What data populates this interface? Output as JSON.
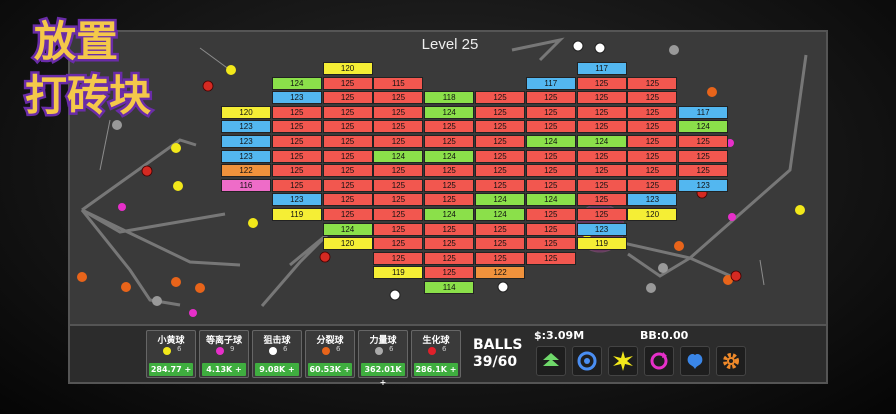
{
  "logo": {
    "line1": "放置",
    "line2": "打砖块"
  },
  "level": "Level 25",
  "hud": {
    "balls_label": "BALLS",
    "balls_count": "39/60",
    "money": "$:3.09M",
    "bb": "BB:0.00"
  },
  "ball_types": [
    {
      "name": "小黄球",
      "count": "6",
      "price": "284.77",
      "color": "#f2e81a"
    },
    {
      "name": "等离子球",
      "count": "9",
      "price": "4.13K",
      "color": "#e62fc9"
    },
    {
      "name": "狙击球",
      "count": "6",
      "price": "9.08K",
      "color": "#ffffff"
    },
    {
      "name": "分裂球",
      "count": "6",
      "price": "60.53K",
      "color": "#e8641a"
    },
    {
      "name": "力量球",
      "count": "6",
      "price": "362.01K",
      "color": "#aaaaaa"
    },
    {
      "name": "生化球",
      "count": "6",
      "price": "286.1K",
      "color": "#e0202a"
    }
  ],
  "tools": [
    "upgrade-arrows-icon",
    "vortex-icon",
    "burst-icon",
    "refresh-icon",
    "brain-icon",
    "gear-icon"
  ],
  "colors": {
    "red": "#f2574f",
    "green": "#8be04a",
    "blue": "#53b7f0",
    "yellow": "#f5ee35",
    "pink": "#ee6cc8",
    "orange": "#f0923c"
  },
  "bricks": [
    {
      "c": 2,
      "r": 0,
      "v": "120",
      "k": "yellow"
    },
    {
      "c": 7,
      "r": 0,
      "v": "117",
      "k": "blue"
    },
    {
      "c": 1,
      "r": 1,
      "v": "124",
      "k": "green"
    },
    {
      "c": 2,
      "r": 1,
      "v": "125",
      "k": "red"
    },
    {
      "c": 3,
      "r": 1,
      "v": "115",
      "k": "red"
    },
    {
      "c": 6,
      "r": 1,
      "v": "117",
      "k": "blue"
    },
    {
      "c": 7,
      "r": 1,
      "v": "125",
      "k": "red"
    },
    {
      "c": 8,
      "r": 1,
      "v": "125",
      "k": "red"
    },
    {
      "c": 1,
      "r": 2,
      "v": "123",
      "k": "blue"
    },
    {
      "c": 2,
      "r": 2,
      "v": "125",
      "k": "red"
    },
    {
      "c": 3,
      "r": 2,
      "v": "125",
      "k": "red"
    },
    {
      "c": 4,
      "r": 2,
      "v": "118",
      "k": "green"
    },
    {
      "c": 5,
      "r": 2,
      "v": "125",
      "k": "red"
    },
    {
      "c": 6,
      "r": 2,
      "v": "125",
      "k": "red"
    },
    {
      "c": 7,
      "r": 2,
      "v": "125",
      "k": "red"
    },
    {
      "c": 8,
      "r": 2,
      "v": "125",
      "k": "red"
    },
    {
      "c": 0,
      "r": 3,
      "v": "120",
      "k": "yellow"
    },
    {
      "c": 1,
      "r": 3,
      "v": "125",
      "k": "red"
    },
    {
      "c": 2,
      "r": 3,
      "v": "125",
      "k": "red"
    },
    {
      "c": 3,
      "r": 3,
      "v": "125",
      "k": "red"
    },
    {
      "c": 4,
      "r": 3,
      "v": "124",
      "k": "green"
    },
    {
      "c": 5,
      "r": 3,
      "v": "125",
      "k": "red"
    },
    {
      "c": 6,
      "r": 3,
      "v": "125",
      "k": "red"
    },
    {
      "c": 7,
      "r": 3,
      "v": "125",
      "k": "red"
    },
    {
      "c": 8,
      "r": 3,
      "v": "125",
      "k": "red"
    },
    {
      "c": 9,
      "r": 3,
      "v": "117",
      "k": "blue"
    },
    {
      "c": 0,
      "r": 4,
      "v": "123",
      "k": "blue"
    },
    {
      "c": 1,
      "r": 4,
      "v": "125",
      "k": "red"
    },
    {
      "c": 2,
      "r": 4,
      "v": "125",
      "k": "red"
    },
    {
      "c": 3,
      "r": 4,
      "v": "125",
      "k": "red"
    },
    {
      "c": 4,
      "r": 4,
      "v": "125",
      "k": "red"
    },
    {
      "c": 5,
      "r": 4,
      "v": "125",
      "k": "red"
    },
    {
      "c": 6,
      "r": 4,
      "v": "125",
      "k": "red"
    },
    {
      "c": 7,
      "r": 4,
      "v": "125",
      "k": "red"
    },
    {
      "c": 8,
      "r": 4,
      "v": "125",
      "k": "red"
    },
    {
      "c": 9,
      "r": 4,
      "v": "124",
      "k": "green"
    },
    {
      "c": 0,
      "r": 5,
      "v": "123",
      "k": "blue"
    },
    {
      "c": 1,
      "r": 5,
      "v": "125",
      "k": "red"
    },
    {
      "c": 2,
      "r": 5,
      "v": "125",
      "k": "red"
    },
    {
      "c": 3,
      "r": 5,
      "v": "125",
      "k": "red"
    },
    {
      "c": 4,
      "r": 5,
      "v": "125",
      "k": "red"
    },
    {
      "c": 5,
      "r": 5,
      "v": "125",
      "k": "red"
    },
    {
      "c": 6,
      "r": 5,
      "v": "124",
      "k": "green"
    },
    {
      "c": 7,
      "r": 5,
      "v": "124",
      "k": "green"
    },
    {
      "c": 8,
      "r": 5,
      "v": "125",
      "k": "red"
    },
    {
      "c": 9,
      "r": 5,
      "v": "125",
      "k": "red"
    },
    {
      "c": 0,
      "r": 6,
      "v": "123",
      "k": "blue"
    },
    {
      "c": 1,
      "r": 6,
      "v": "125",
      "k": "red"
    },
    {
      "c": 2,
      "r": 6,
      "v": "125",
      "k": "red"
    },
    {
      "c": 3,
      "r": 6,
      "v": "124",
      "k": "green"
    },
    {
      "c": 4,
      "r": 6,
      "v": "124",
      "k": "green"
    },
    {
      "c": 5,
      "r": 6,
      "v": "125",
      "k": "red"
    },
    {
      "c": 6,
      "r": 6,
      "v": "125",
      "k": "red"
    },
    {
      "c": 7,
      "r": 6,
      "v": "125",
      "k": "red"
    },
    {
      "c": 8,
      "r": 6,
      "v": "125",
      "k": "red"
    },
    {
      "c": 9,
      "r": 6,
      "v": "125",
      "k": "red"
    },
    {
      "c": 0,
      "r": 7,
      "v": "122",
      "k": "orange"
    },
    {
      "c": 1,
      "r": 7,
      "v": "125",
      "k": "red"
    },
    {
      "c": 2,
      "r": 7,
      "v": "125",
      "k": "red"
    },
    {
      "c": 3,
      "r": 7,
      "v": "125",
      "k": "red"
    },
    {
      "c": 4,
      "r": 7,
      "v": "125",
      "k": "red"
    },
    {
      "c": 5,
      "r": 7,
      "v": "125",
      "k": "red"
    },
    {
      "c": 6,
      "r": 7,
      "v": "125",
      "k": "red"
    },
    {
      "c": 7,
      "r": 7,
      "v": "125",
      "k": "red"
    },
    {
      "c": 8,
      "r": 7,
      "v": "125",
      "k": "red"
    },
    {
      "c": 9,
      "r": 7,
      "v": "125",
      "k": "red"
    },
    {
      "c": 0,
      "r": 8,
      "v": "116",
      "k": "pink"
    },
    {
      "c": 1,
      "r": 8,
      "v": "125",
      "k": "red"
    },
    {
      "c": 2,
      "r": 8,
      "v": "125",
      "k": "red"
    },
    {
      "c": 3,
      "r": 8,
      "v": "125",
      "k": "red"
    },
    {
      "c": 4,
      "r": 8,
      "v": "125",
      "k": "red"
    },
    {
      "c": 5,
      "r": 8,
      "v": "125",
      "k": "red"
    },
    {
      "c": 6,
      "r": 8,
      "v": "125",
      "k": "red"
    },
    {
      "c": 7,
      "r": 8,
      "v": "125",
      "k": "red"
    },
    {
      "c": 8,
      "r": 8,
      "v": "125",
      "k": "red"
    },
    {
      "c": 9,
      "r": 8,
      "v": "123",
      "k": "blue"
    },
    {
      "c": 1,
      "r": 9,
      "v": "123",
      "k": "blue"
    },
    {
      "c": 2,
      "r": 9,
      "v": "125",
      "k": "red"
    },
    {
      "c": 3,
      "r": 9,
      "v": "125",
      "k": "red"
    },
    {
      "c": 4,
      "r": 9,
      "v": "125",
      "k": "red"
    },
    {
      "c": 5,
      "r": 9,
      "v": "124",
      "k": "green"
    },
    {
      "c": 6,
      "r": 9,
      "v": "124",
      "k": "green"
    },
    {
      "c": 7,
      "r": 9,
      "v": "125",
      "k": "red"
    },
    {
      "c": 8,
      "r": 9,
      "v": "123",
      "k": "blue"
    },
    {
      "c": 1,
      "r": 10,
      "v": "119",
      "k": "yellow"
    },
    {
      "c": 2,
      "r": 10,
      "v": "125",
      "k": "red"
    },
    {
      "c": 3,
      "r": 10,
      "v": "125",
      "k": "red"
    },
    {
      "c": 4,
      "r": 10,
      "v": "124",
      "k": "green"
    },
    {
      "c": 5,
      "r": 10,
      "v": "124",
      "k": "green"
    },
    {
      "c": 6,
      "r": 10,
      "v": "125",
      "k": "red"
    },
    {
      "c": 7,
      "r": 10,
      "v": "125",
      "k": "red"
    },
    {
      "c": 8,
      "r": 10,
      "v": "120",
      "k": "yellow"
    },
    {
      "c": 2,
      "r": 11,
      "v": "124",
      "k": "green"
    },
    {
      "c": 3,
      "r": 11,
      "v": "125",
      "k": "red"
    },
    {
      "c": 4,
      "r": 11,
      "v": "125",
      "k": "red"
    },
    {
      "c": 5,
      "r": 11,
      "v": "125",
      "k": "red"
    },
    {
      "c": 6,
      "r": 11,
      "v": "125",
      "k": "red"
    },
    {
      "c": 7,
      "r": 11,
      "v": "123",
      "k": "blue"
    },
    {
      "c": 2,
      "r": 12,
      "v": "120",
      "k": "yellow"
    },
    {
      "c": 3,
      "r": 12,
      "v": "125",
      "k": "red"
    },
    {
      "c": 4,
      "r": 12,
      "v": "125",
      "k": "red"
    },
    {
      "c": 5,
      "r": 12,
      "v": "125",
      "k": "red"
    },
    {
      "c": 6,
      "r": 12,
      "v": "125",
      "k": "red"
    },
    {
      "c": 7,
      "r": 12,
      "v": "119",
      "k": "yellow"
    },
    {
      "c": 3,
      "r": 13,
      "v": "125",
      "k": "red"
    },
    {
      "c": 4,
      "r": 13,
      "v": "125",
      "k": "red"
    },
    {
      "c": 5,
      "r": 13,
      "v": "125",
      "k": "red"
    },
    {
      "c": 6,
      "r": 13,
      "v": "125",
      "k": "red"
    },
    {
      "c": 3,
      "r": 14,
      "v": "119",
      "k": "yellow"
    },
    {
      "c": 4,
      "r": 14,
      "v": "125",
      "k": "red"
    },
    {
      "c": 5,
      "r": 14,
      "v": "122",
      "k": "orange"
    },
    {
      "c": 4,
      "r": 15,
      "v": "114",
      "k": "green"
    }
  ]
}
